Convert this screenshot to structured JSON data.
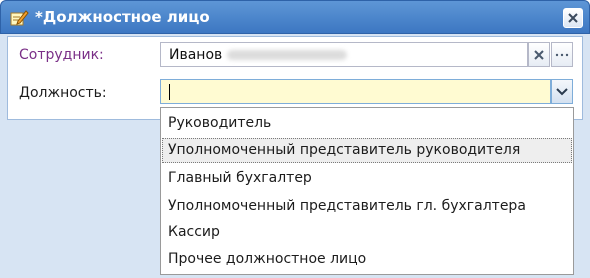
{
  "window": {
    "title": "*Должностное лицо",
    "title_icon": "edit-icon",
    "close_icon": "close-icon"
  },
  "form": {
    "employee_label": "Сотрудник:",
    "employee_value": "Иванов",
    "position_label": "Должность:",
    "position_value": "",
    "clear_icon": "clear-icon",
    "more_icon": "ellipsis-icon",
    "dropdown_icon": "chevron-down-icon"
  },
  "dropdown": {
    "options": [
      {
        "label": "Руководитель",
        "highlighted": false
      },
      {
        "label": "Уполномоченный представитель руководителя",
        "highlighted": true
      },
      {
        "label": "Главный бухгалтер",
        "highlighted": false
      },
      {
        "label": "Уполномоченный представитель гл. бухгалтера",
        "highlighted": false
      },
      {
        "label": "Кассир",
        "highlighted": false
      },
      {
        "label": "Прочее должностное лицо",
        "highlighted": false
      }
    ]
  },
  "colors": {
    "title_bar": "#3c77c2",
    "employee_label": "#7a2f87",
    "active_field": "#fffbd2"
  }
}
